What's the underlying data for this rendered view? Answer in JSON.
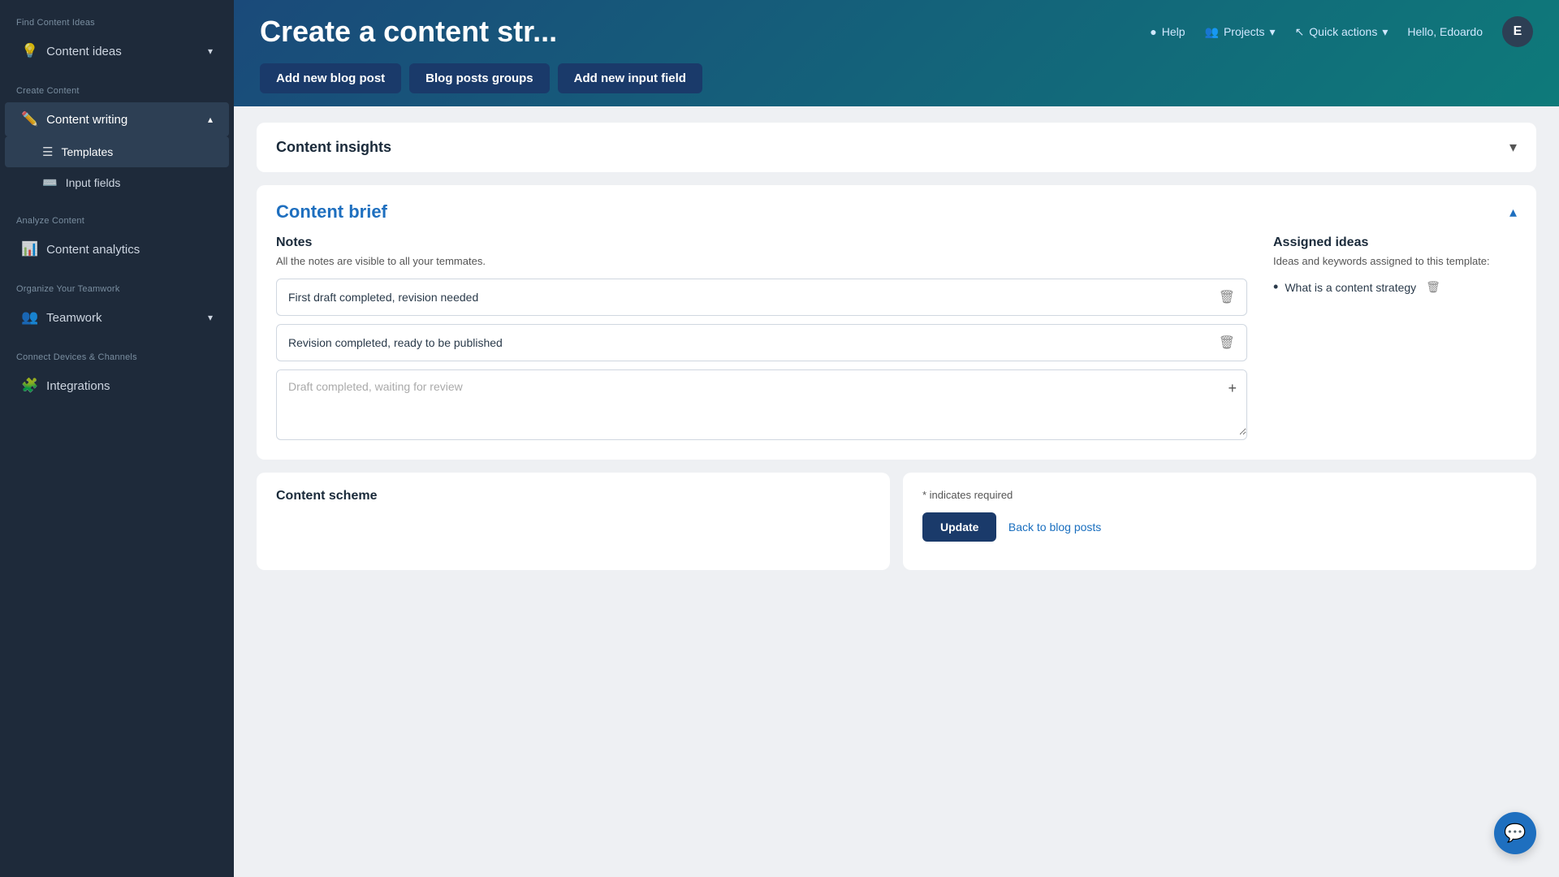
{
  "sidebar": {
    "sections": [
      {
        "label": "Find Content Ideas",
        "items": [
          {
            "id": "content-ideas",
            "label": "Content ideas",
            "icon": "💡",
            "hasChevron": true,
            "active": false
          }
        ]
      },
      {
        "label": "Create Content",
        "items": [
          {
            "id": "content-writing",
            "label": "Content writing",
            "icon": "✏️",
            "hasChevron": true,
            "active": true,
            "subitems": [
              {
                "id": "templates",
                "label": "Templates",
                "icon": "☰",
                "active": true
              },
              {
                "id": "input-fields",
                "label": "Input fields",
                "icon": "⌨️",
                "active": false
              }
            ]
          }
        ]
      },
      {
        "label": "Analyze Content",
        "items": [
          {
            "id": "content-analytics",
            "label": "Content analytics",
            "icon": "📊",
            "hasChevron": false,
            "active": false
          }
        ]
      },
      {
        "label": "Organize Your Teamwork",
        "items": [
          {
            "id": "teamwork",
            "label": "Teamwork",
            "icon": "👥",
            "hasChevron": true,
            "active": false
          }
        ]
      },
      {
        "label": "Connect Devices & Channels",
        "items": [
          {
            "id": "integrations",
            "label": "Integrations",
            "icon": "🧩",
            "hasChevron": false,
            "active": false
          }
        ]
      }
    ]
  },
  "header": {
    "title": "Create a content str...",
    "nav": {
      "help_label": "Help",
      "projects_label": "Projects",
      "quick_actions_label": "Quick actions",
      "hello_text": "Hello, Edoardo",
      "avatar_letter": "E"
    },
    "actions": [
      {
        "id": "add-blog-post",
        "label": "Add new blog post"
      },
      {
        "id": "blog-posts-groups",
        "label": "Blog posts groups"
      },
      {
        "id": "add-input-field",
        "label": "Add new input field"
      }
    ]
  },
  "content_insights": {
    "title": "Content insights"
  },
  "content_brief": {
    "title": "Content brief",
    "notes": {
      "section_title": "Notes",
      "section_subtitle": "All the notes are visible to all your temmates.",
      "items": [
        {
          "id": "note-1",
          "text": "First draft completed, revision needed"
        },
        {
          "id": "note-2",
          "text": "Revision completed, ready to be published"
        }
      ],
      "textarea_placeholder": "Draft completed, waiting for review"
    },
    "assigned_ideas": {
      "section_title": "Assigned ideas",
      "section_subtitle": "Ideas and keywords assigned to this template:",
      "items": [
        {
          "id": "idea-1",
          "text": "What is a content strategy"
        }
      ]
    }
  },
  "content_scheme": {
    "title": "Content scheme"
  },
  "form": {
    "required_text": "* indicates required",
    "update_label": "Update",
    "back_label": "Back to blog posts"
  }
}
